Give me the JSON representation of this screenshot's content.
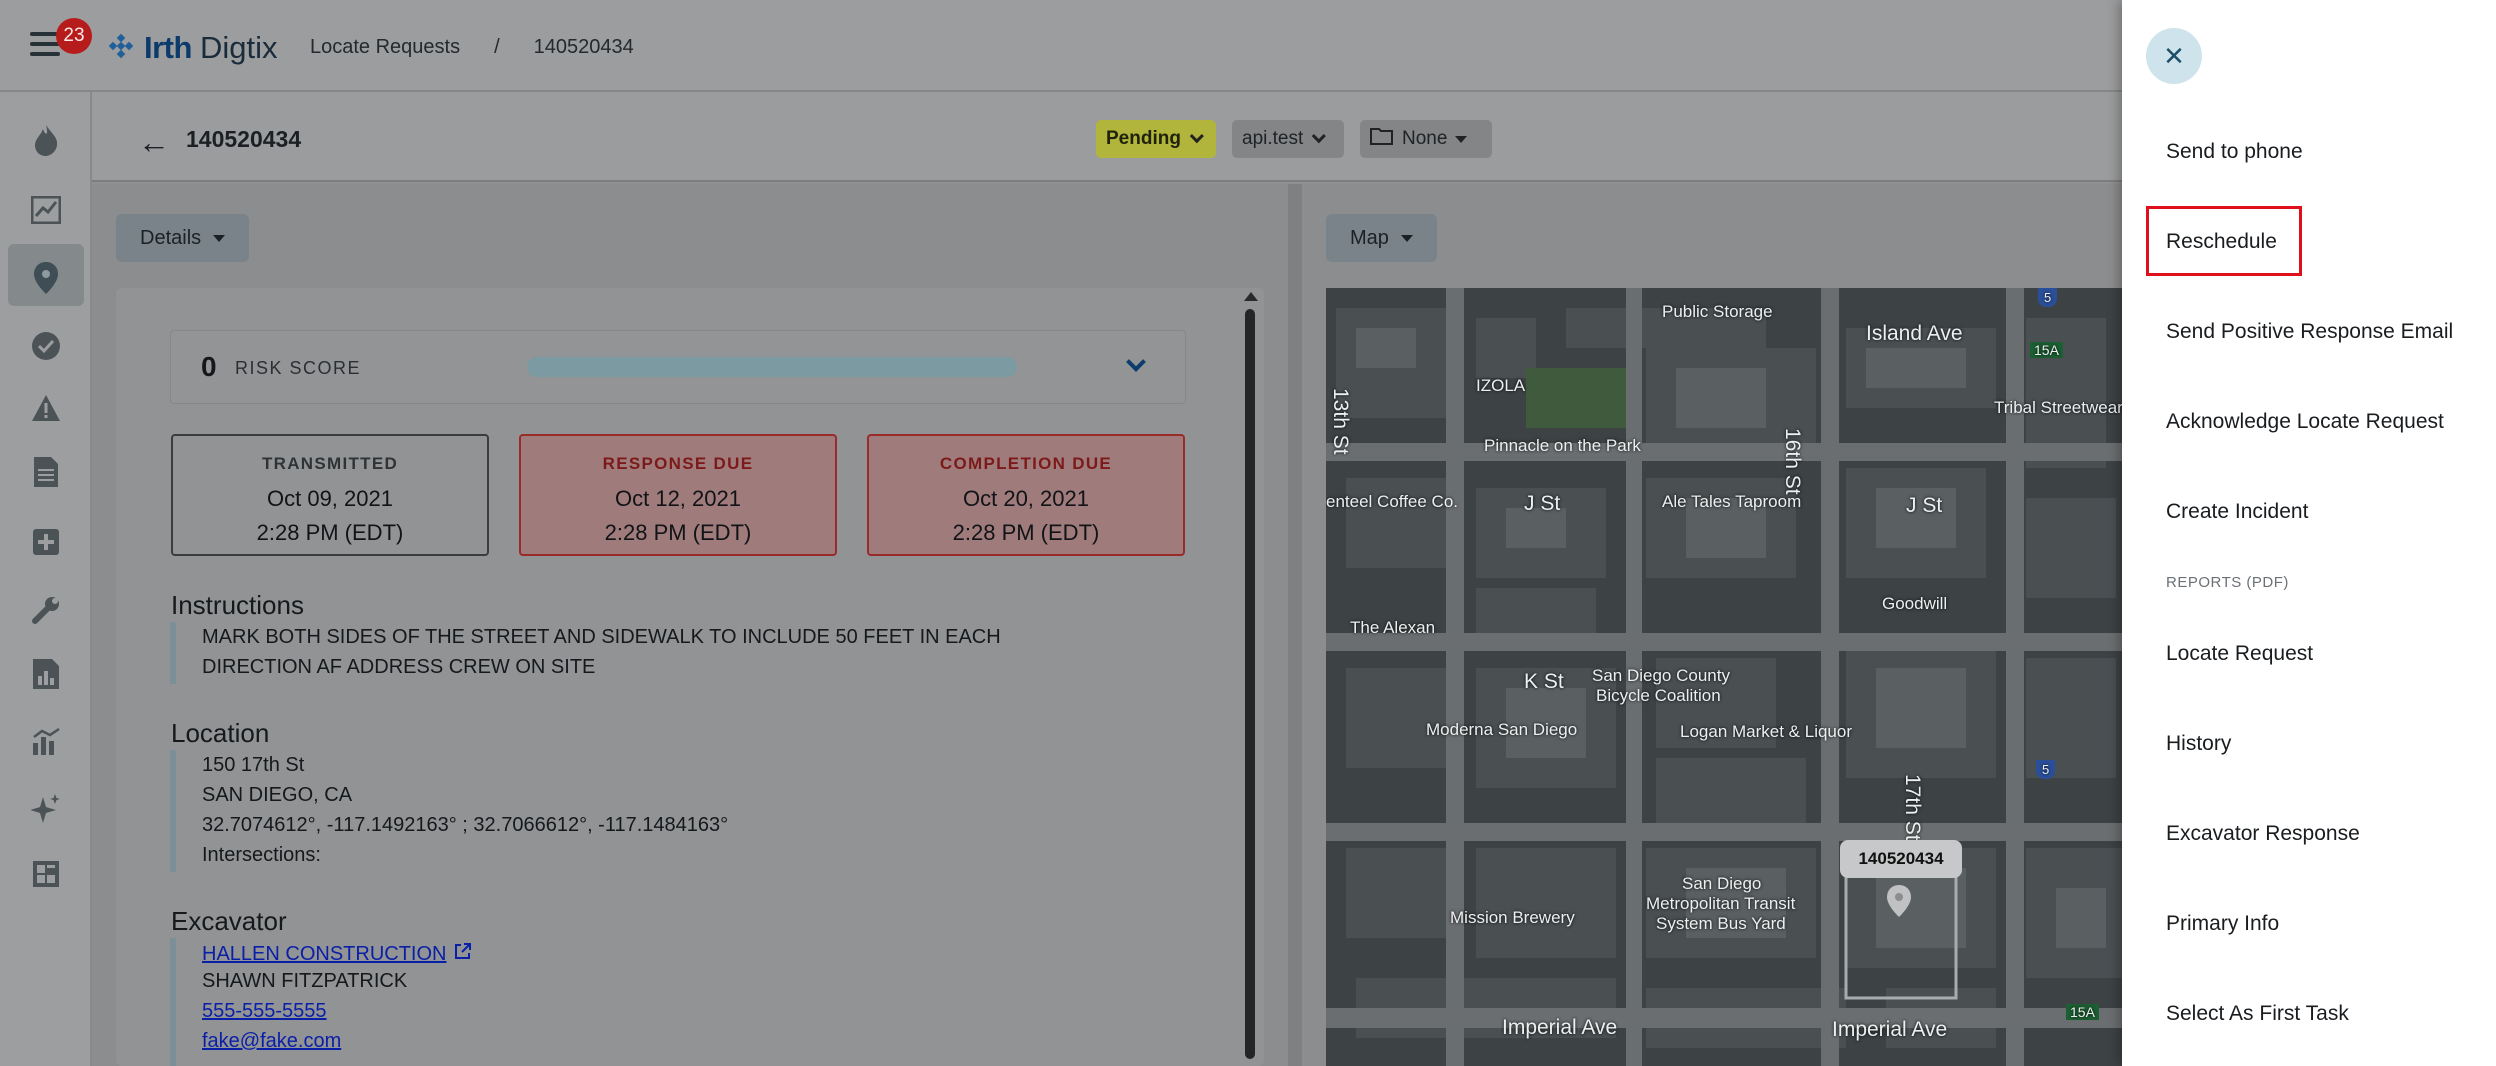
{
  "app": {
    "logo_brand": "Irth",
    "logo_product": "Digtix",
    "notification_count": "23",
    "breadcrumb": [
      "Locate Requests",
      "/",
      "140520434"
    ]
  },
  "sidebar": {
    "icons": [
      "flame-icon",
      "trend-chart-icon",
      "map-pin-icon",
      "check-circle-icon",
      "warning-icon",
      "document-icon",
      "plus-icon",
      "wrench-icon",
      "report-icon",
      "bar-chart-icon",
      "sparkle-icon",
      "grid-icon"
    ]
  },
  "ticket": {
    "number": "140520434",
    "status": "Pending",
    "assignee": "api.test",
    "folder": "None"
  },
  "details": {
    "tab_label": "Details",
    "risk_score": "0",
    "risk_label": "RISK SCORE",
    "dates": [
      {
        "label": "TRANSMITTED",
        "date": "Oct 09, 2021",
        "time": "2:28 PM (EDT)"
      },
      {
        "label": "RESPONSE DUE",
        "date": "Oct 12, 2021",
        "time": "2:28 PM (EDT)"
      },
      {
        "label": "COMPLETION DUE",
        "date": "Oct 20, 2021",
        "time": "2:28 PM (EDT)"
      }
    ],
    "instructions_title": "Instructions",
    "instructions_lines": [
      "MARK BOTH SIDES OF THE STREET AND SIDEWALK TO INCLUDE 50 FEET IN EACH",
      "DIRECTION AF ADDRESS CREW ON SITE"
    ],
    "location_title": "Location",
    "location_lines": [
      "150 17th St",
      "SAN DIEGO, CA",
      "32.7074612°, -117.1492163° ; 32.7066612°, -117.1484163°",
      "Intersections:"
    ],
    "excavator_title": "Excavator",
    "excavator_company": "HALLEN CONSTRUCTION",
    "excavator_contact": "SHAWN FITZPATRICK",
    "excavator_phone": "555-555-5555",
    "excavator_email": "fake@fake.com"
  },
  "map": {
    "tab_label": "Map",
    "pin_label": "140520434",
    "labels": {
      "public_storage": "Public Storage",
      "island_ave": "Island Ave",
      "izola": "IZOLA",
      "tribal": "Tribal Streetwear",
      "pinnacle": "Pinnacle on the Park",
      "st16": "16th St",
      "st13": "13th St",
      "coffee": "enteel Coffee Co.",
      "jst1": "J St",
      "ale": "Ale Tales Taproom",
      "jst2": "J St",
      "goodwill": "Goodwill",
      "alexan": "The Alexan",
      "kst": "K St",
      "bike1": "San Diego County",
      "bike2": "Bicycle Coalition",
      "moderna": "Moderna San Diego",
      "logan": "Logan Market & Liquor",
      "st17": "17th St",
      "sd": "San Diego",
      "mts1": "Metropolitan Transit",
      "mts2": "System Bus Yard",
      "mission": "Mission Brewery",
      "imperial1": "Imperial Ave",
      "imperial2": "Imperial Ave",
      "h15a_1": "15A",
      "h15a_2": "15A",
      "i5": "5"
    }
  },
  "drawer": {
    "items": [
      "Send to phone",
      "Reschedule",
      "Send Positive Response Email",
      "Acknowledge Locate Request",
      "Create Incident"
    ],
    "reports_section": "REPORTS (PDF)",
    "report_items": [
      "Locate Request",
      "History",
      "Excavator Response",
      "Primary Info",
      "Select As First Task"
    ]
  }
}
